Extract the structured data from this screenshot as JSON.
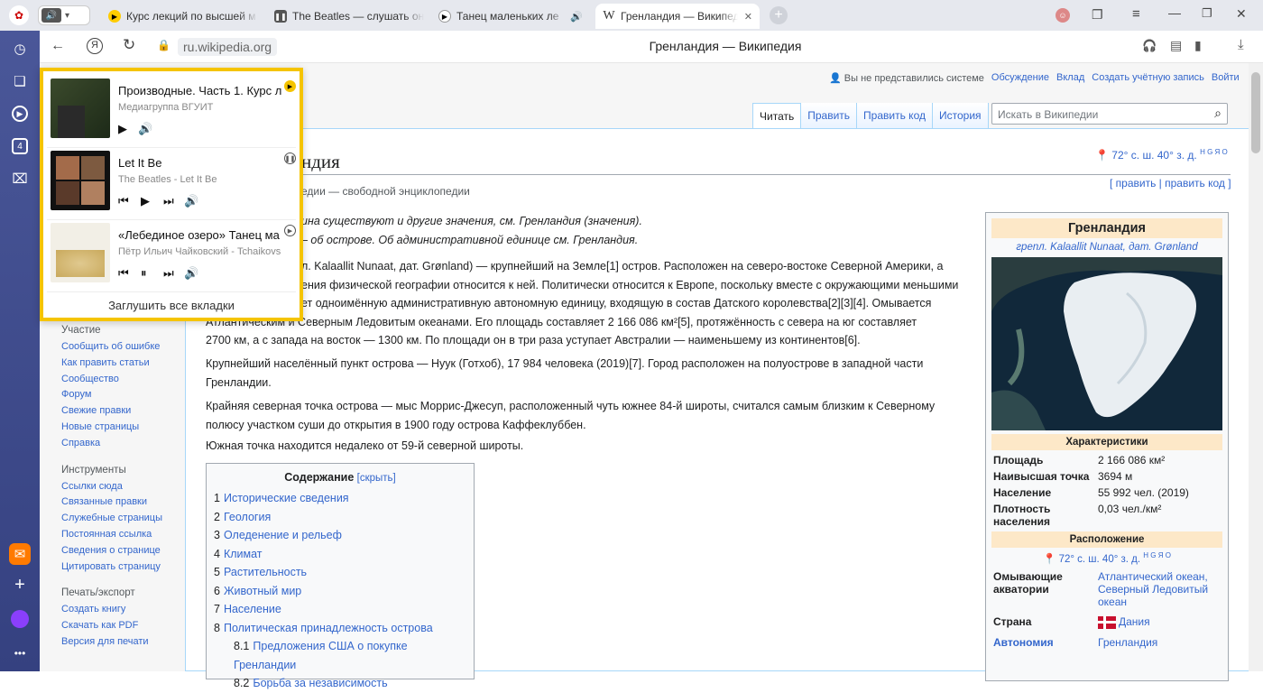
{
  "tabs": [
    {
      "label": "Курс лекций по высшей м",
      "icon": "play-icon"
    },
    {
      "label": "The Beatles — слушать он",
      "icon": "pause-icon"
    },
    {
      "label": "Танец маленьких ле",
      "icon": "play-icon"
    },
    {
      "label": "Гренландия — Википедия",
      "icon": "wikipedia-icon"
    }
  ],
  "address": {
    "url": "ru.wikipedia.org",
    "page_title": "Гренландия — Википедия"
  },
  "media": {
    "items": [
      {
        "title": "Производные. Часть 1. Курс л",
        "artist": "Медиагруппа ВГУИТ"
      },
      {
        "title": "Let It Be",
        "artist": "The Beatles - Let It Be"
      },
      {
        "title": "«Лебединое озеро» Танец ма",
        "artist": "Пётр Ильич Чайковский - Tchaikovs"
      }
    ],
    "mute_all": "Заглушить все вкладки"
  },
  "wiki": {
    "personal": [
      "Вы не представились системе",
      "Обсуждение",
      "Вклад",
      "Создать учётную запись",
      "Войти"
    ],
    "views": [
      "Читать",
      "Править",
      "Править код",
      "История"
    ],
    "search_placeholder": "Искать в Википедии",
    "title_fragment": "ндия",
    "coords": "72° с. ш. 40° з. д.",
    "coord_sup": "H G Я O",
    "edit_links": "[ править | править код ]",
    "subtitle": "едии — свободной энциклопедии",
    "hatnote1": "ина существуют и другие значения, см. Гренландия (значения).",
    "hatnote2": "– об острове. Об административной единице см. Гренландия.",
    "para1_l1": "л. Kalaallit Nunaat, дат. Grønland) — крупнейший на Земле[1] остров. Расположен на северо-востоке Северной Америки, а",
    "para1_l2": "ения физической географии относится к ней. Политически относится к Европе, поскольку вместе с окружающими меньшими",
    "para1_l3": "ет одноимённую административную автономную единицу, входящую в состав Датского королевства[2][3][4]. Омывается",
    "para1_l4": "Атлантическим и Северным Ледовитым океанами. Его площадь составляет 2 166 086 км²[5], протяжённость с севера на юг составляет",
    "para1_l5": "2700 км, а с запада на восток — 1300 км. По площади он в три раза уступает Австралии — наименьшему из континентов[6].",
    "para2": "Крупнейший населённый пункт острова — Нуук (Готхоб), 17 984 человека (2019)[7]. Город расположен на полуострове в западной части Гренландии.",
    "para3": "Крайняя северная точка острова — мыс Моррис-Джесуп, расположенный чуть южнее 84-й широты, считался самым близким к Северному полюсу участком суши до открытия в 1900 году острова Каффеклуббен.",
    "para4": "Южная точка находится недалеко от 59-й северной широты.",
    "portal": {
      "h1": "Участие",
      "l1": [
        "Сообщить об ошибке",
        "Как править статьи",
        "Сообщество",
        "Форум",
        "Свежие правки",
        "Новые страницы",
        "Справка"
      ],
      "h2": "Инструменты",
      "l2": [
        "Ссылки сюда",
        "Связанные правки",
        "Служебные страницы",
        "Постоянная ссылка",
        "Сведения о странице",
        "Цитировать страницу"
      ],
      "h3": "Печать/экспорт",
      "l3": [
        "Создать книгу",
        "Скачать как PDF",
        "Версия для печати"
      ]
    },
    "toc": {
      "title": "Содержание",
      "hide": "[скрыть]",
      "items": [
        {
          "n": "1",
          "t": "Исторические сведения"
        },
        {
          "n": "2",
          "t": "Геология"
        },
        {
          "n": "3",
          "t": "Оледенение и рельеф"
        },
        {
          "n": "4",
          "t": "Климат"
        },
        {
          "n": "5",
          "t": "Растительность"
        },
        {
          "n": "6",
          "t": "Животный мир"
        },
        {
          "n": "7",
          "t": "Население"
        },
        {
          "n": "8",
          "t": "Политическая принадлежность острова"
        },
        {
          "n": "8.1",
          "t": "Предложения США о покупке Гренландии"
        },
        {
          "n": "8.2",
          "t": "Борьба за независимость"
        }
      ]
    },
    "infobox": {
      "title": "Гренландия",
      "names": "грenл. Kalaallit Nunaat, дат. Grønland",
      "h_char": "Характеристики",
      "rows": [
        {
          "k": "Площадь",
          "v": "2 166 086 км²"
        },
        {
          "k": "Наивысшая точка",
          "v": "3694 м"
        },
        {
          "k": "Население",
          "v": "55 992 чел. (2019)"
        },
        {
          "k": "Плотность населения",
          "v": "0,03 чел./км²"
        }
      ],
      "h_loc": "Расположение",
      "loc_coords": "72° с. ш. 40° з. д.",
      "waters_k": "Омывающие акватории",
      "waters_v": "Атлантический океан, Северный Ледовитый океан",
      "country_k": "Страна",
      "country_v": "Дания",
      "autonomy_k": "Автономия",
      "autonomy_v": "Гренландия"
    }
  },
  "colors": {
    "accent": "#f5c400",
    "sidebar": "#3e4b8c",
    "link": "#3366cc"
  }
}
